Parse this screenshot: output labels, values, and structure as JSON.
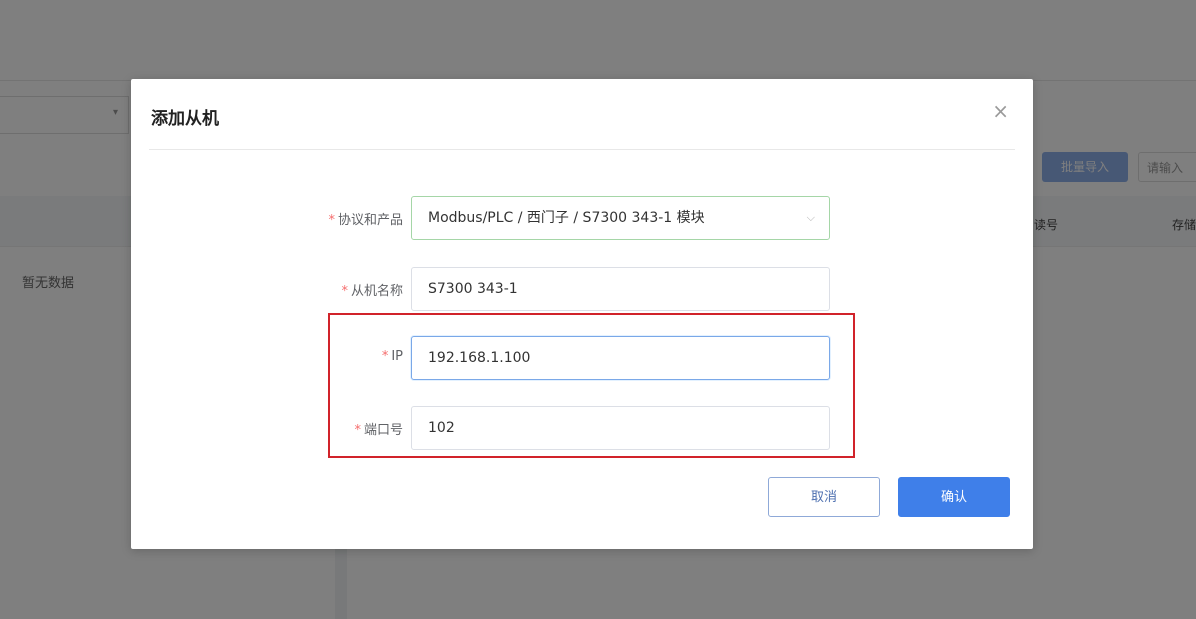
{
  "background": {
    "empty_text": "暂无数据",
    "right_button_label": "批量导入",
    "right_input_placeholder": "请输入",
    "columns": [
      "读号",
      "存储"
    ]
  },
  "dialog": {
    "title": "添加从机",
    "close_icon": "×",
    "fields": [
      {
        "label": "协议和产品",
        "value": "Modbus/PLC / 西门子 / S7300 343-1 模块",
        "type": "select"
      },
      {
        "label": "从机名称",
        "value": "S7300 343-1",
        "type": "input"
      },
      {
        "label": "IP",
        "value": "192.168.1.100",
        "type": "input"
      },
      {
        "label": "端口号",
        "value": "102",
        "type": "input"
      }
    ],
    "cancel_label": "取消",
    "confirm_label": "确认"
  },
  "colors": {
    "primary": "#3f7fe9",
    "required": "#f56c6c",
    "highlight": "#d1232a"
  }
}
